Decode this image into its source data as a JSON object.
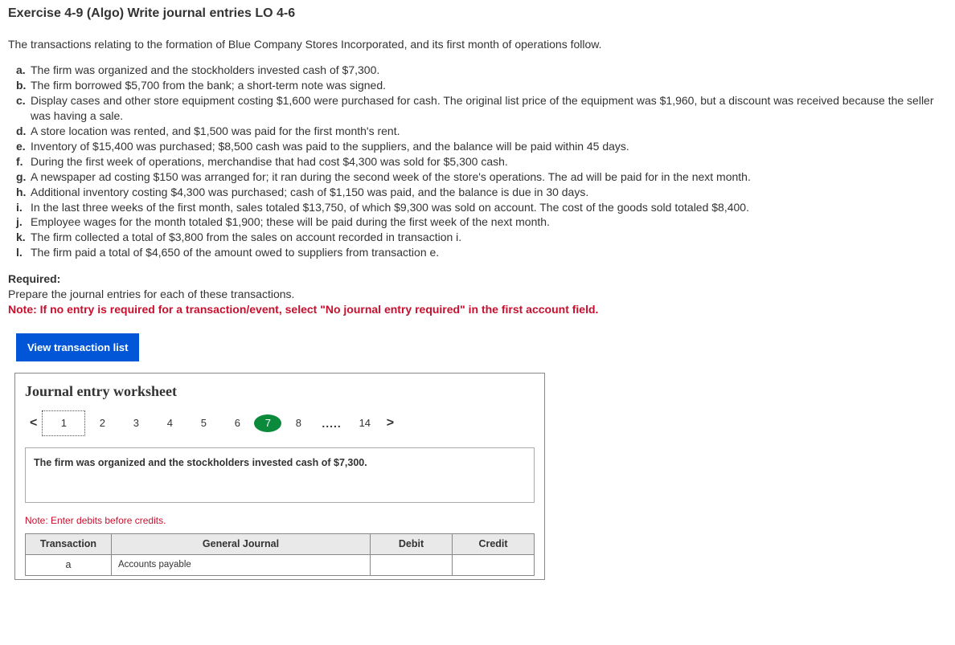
{
  "title": "Exercise 4-9 (Algo) Write journal entries LO 4-6",
  "intro": "The transactions relating to the formation of Blue Company Stores Incorporated, and its first month of operations follow.",
  "transactions": [
    {
      "m": "a.",
      "t": "The firm was organized and the stockholders invested cash of $7,300."
    },
    {
      "m": "b.",
      "t": "The firm borrowed $5,700 from the bank; a short-term note was signed."
    },
    {
      "m": "c.",
      "t": "Display cases and other store equipment costing $1,600 were purchased for cash. The original list price of the equipment was $1,960, but a discount was received because the seller was having a sale."
    },
    {
      "m": "d.",
      "t": "A store location was rented, and $1,500 was paid for the first month's rent."
    },
    {
      "m": "e.",
      "t": "Inventory of $15,400 was purchased; $8,500 cash was paid to the suppliers, and the balance will be paid within 45 days."
    },
    {
      "m": "f.",
      "t": "During the first week of operations, merchandise that had cost $4,300 was sold for $5,300 cash."
    },
    {
      "m": "g.",
      "t": "A newspaper ad costing $150 was arranged for; it ran during the second week of the store's operations. The ad will be paid for in the next month."
    },
    {
      "m": "h.",
      "t": "Additional inventory costing $4,300 was purchased; cash of $1,150 was paid, and the balance is due in 30 days."
    },
    {
      "m": "i.",
      "t": "In the last three weeks of the first month, sales totaled $13,750, of which $9,300 was sold on account. The cost of the goods sold totaled $8,400."
    },
    {
      "m": "j.",
      "t": "Employee wages for the month totaled $1,900; these will be paid during the first week of the next month."
    },
    {
      "m": "k.",
      "t": "The firm collected a total of $3,800 from the sales on account recorded in transaction i."
    },
    {
      "m": "l.",
      "t": "The firm paid a total of $4,650 of the amount owed to suppliers from transaction e."
    }
  ],
  "required_label": "Required:",
  "required_text": "Prepare the journal entries for each of these transactions.",
  "note_red": "Note: If no entry is required for a transaction/event, select \"No journal entry required\" in the first account field.",
  "view_btn": "View transaction list",
  "ws_title": "Journal entry worksheet",
  "pager": {
    "prev": "<",
    "next": ">",
    "nums": [
      "1",
      "2",
      "3",
      "4",
      "5",
      "6",
      "7",
      "8"
    ],
    "dots": ".....",
    "last": "14",
    "active": "7",
    "boxed": "1"
  },
  "prompt": "The firm was organized and the stockholders invested cash of $7,300.",
  "note_small": "Note: Enter debits before credits.",
  "table": {
    "headers": [
      "Transaction",
      "General Journal",
      "Debit",
      "Credit"
    ],
    "row": {
      "txn": "a",
      "acct": "Accounts payable"
    }
  }
}
